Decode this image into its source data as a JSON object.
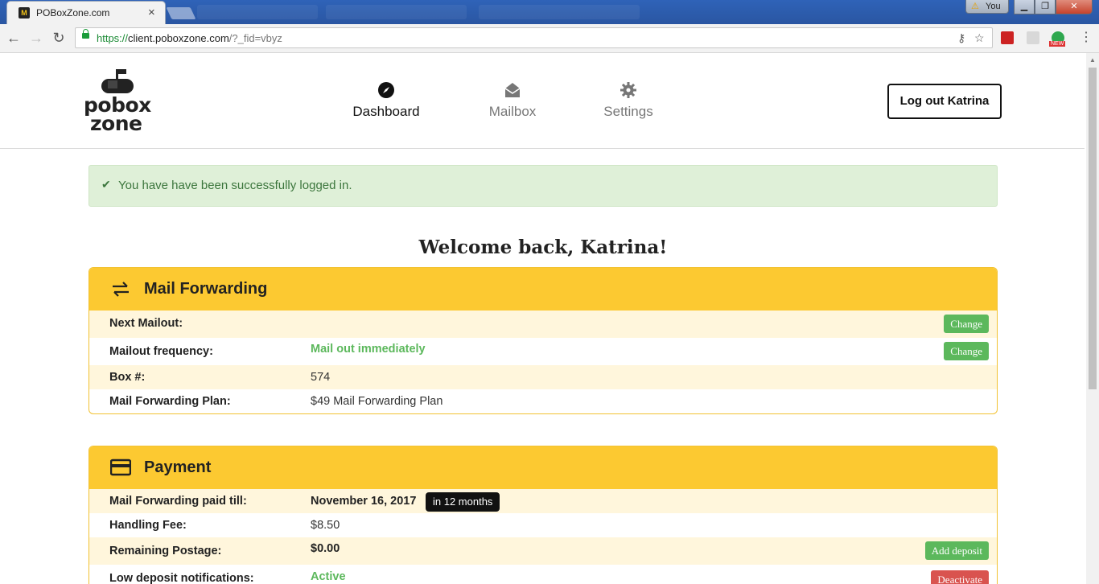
{
  "browser": {
    "tab_title": "POBoxZone.com",
    "tab_close": "×",
    "user_name": "You",
    "url_scheme": "https://",
    "url_host": "client.poboxzone.com",
    "url_path": "/?_fid=vbyz",
    "ext_new_badge": "NEW"
  },
  "site": {
    "logo_line1": "pobox",
    "logo_line2": "zone",
    "nav": [
      {
        "label": "Dashboard",
        "icon": "compass-icon",
        "active": true
      },
      {
        "label": "Mailbox",
        "icon": "envelope-open-icon",
        "active": false
      },
      {
        "label": "Settings",
        "icon": "gear-icon",
        "active": false
      }
    ],
    "logout_label": "Log out Katrina"
  },
  "alert": {
    "message": "You have have been successfully logged in."
  },
  "welcome": "Welcome back, Katrina!",
  "mail_forwarding": {
    "title": "Mail Forwarding",
    "icon": "exchange-arrows-icon",
    "rows": [
      {
        "label": "Next Mailout:",
        "value": "",
        "button": "Change"
      },
      {
        "label": "Mailout frequency:",
        "value": "Mail out immediately",
        "button": "Change"
      },
      {
        "label": "Box #:",
        "value": "574"
      },
      {
        "label": "Mail Forwarding Plan:",
        "value": "$49 Mail Forwarding Plan"
      }
    ]
  },
  "payment": {
    "title": "Payment",
    "icon": "credit-card-icon",
    "rows": [
      {
        "label": "Mail Forwarding paid till:",
        "value": "November 16, 2017",
        "pill": "in 12 months"
      },
      {
        "label": "Handling Fee:",
        "value": "$8.50"
      },
      {
        "label": "Remaining Postage:",
        "value": "$0.00",
        "button": "Add deposit"
      },
      {
        "label": "Low deposit notifications:",
        "value": "Active",
        "button": "Deactivate"
      }
    ]
  },
  "colors": {
    "card_header": "#fcc931",
    "alt_row": "#fff6dc",
    "success_green": "#5cb85c",
    "danger_red": "#d9534f",
    "alert_bg": "#dff0d8"
  }
}
